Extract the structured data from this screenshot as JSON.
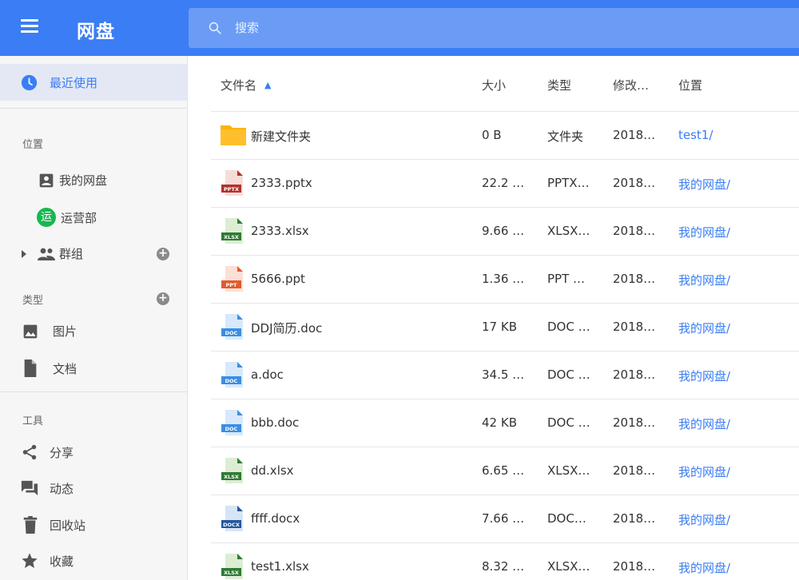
{
  "app": {
    "title": "网盘"
  },
  "search": {
    "placeholder": "搜索"
  },
  "sidebar": {
    "recent": "最近使用",
    "location_label": "位置",
    "my_drive": "我的网盘",
    "team": {
      "avatar": "运",
      "label": "运营部"
    },
    "groups": "群组",
    "type_label": "类型",
    "images": "图片",
    "documents": "文档",
    "tools_label": "工具",
    "share": "分享",
    "activity": "动态",
    "trash": "回收站",
    "favorites": "收藏"
  },
  "table": {
    "headers": {
      "name": "文件名",
      "size": "大小",
      "type": "类型",
      "modified": "修改…",
      "location": "位置"
    },
    "rows": [
      {
        "name": "新建文件夹",
        "size": "0 B",
        "type": "文件夹",
        "modified": "2018…",
        "location": "test1/",
        "icon": "folder-icon"
      },
      {
        "name": "2333.pptx",
        "size": "22.2 …",
        "type": "PPTX…",
        "modified": "2018…",
        "location": "我的网盘/",
        "icon": "pptx-file-icon"
      },
      {
        "name": "2333.xlsx",
        "size": "9.66 …",
        "type": "XLSX…",
        "modified": "2018…",
        "location": "我的网盘/",
        "icon": "xlsx-file-icon"
      },
      {
        "name": "5666.ppt",
        "size": "1.36 …",
        "type": "PPT …",
        "modified": "2018…",
        "location": "我的网盘/",
        "icon": "ppt-file-icon"
      },
      {
        "name": "DDJ简历.doc",
        "size": "17 KB",
        "type": "DOC …",
        "modified": "2018…",
        "location": "我的网盘/",
        "icon": "doc-file-icon"
      },
      {
        "name": "a.doc",
        "size": "34.5 …",
        "type": "DOC …",
        "modified": "2018…",
        "location": "我的网盘/",
        "icon": "doc-file-icon"
      },
      {
        "name": "bbb.doc",
        "size": "42 KB",
        "type": "DOC …",
        "modified": "2018…",
        "location": "我的网盘/",
        "icon": "doc-file-icon"
      },
      {
        "name": "dd.xlsx",
        "size": "6.65 …",
        "type": "XLSX…",
        "modified": "2018…",
        "location": "我的网盘/",
        "icon": "xlsx-file-icon"
      },
      {
        "name": "ffff.docx",
        "size": "7.66 …",
        "type": "DOC…",
        "modified": "2018…",
        "location": "我的网盘/",
        "icon": "docx-file-icon"
      },
      {
        "name": "test1.xlsx",
        "size": "8.32 …",
        "type": "XLSX…",
        "modified": "2018…",
        "location": "我的网盘/",
        "icon": "xlsx-file-icon"
      }
    ]
  },
  "file_icons": {
    "pptx": {
      "tag": "PPTX",
      "color": "#b3312a",
      "bg": "#f6dcd9"
    },
    "xlsx": {
      "tag": "XLSX",
      "color": "#2f7a34",
      "bg": "#dcedd4"
    },
    "ppt": {
      "tag": "PPT",
      "color": "#e35a2d",
      "bg": "#fbe0d6"
    },
    "doc": {
      "tag": "DOC",
      "color": "#3b8ee3",
      "bg": "#d7e9fb"
    },
    "docx": {
      "tag": "DOCX",
      "color": "#23579f",
      "bg": "#d6e4f6"
    }
  },
  "colors": {
    "accent": "#3a7df5",
    "folder": "#ffb300"
  }
}
